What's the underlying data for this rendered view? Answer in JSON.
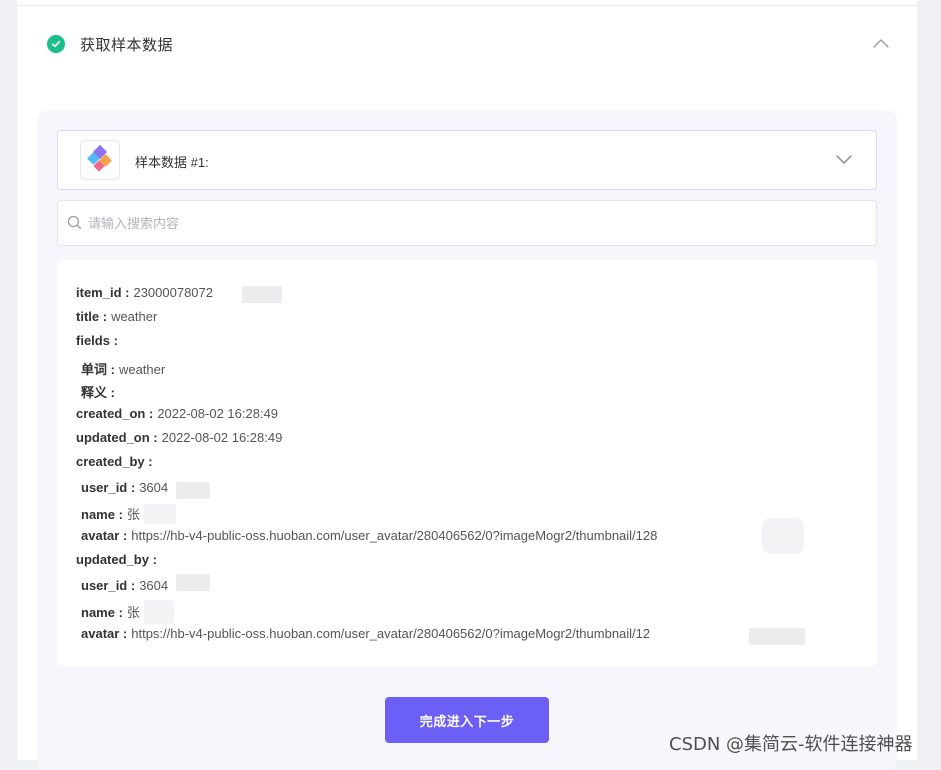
{
  "step": {
    "title": "获取样本数据"
  },
  "selector": {
    "label": "样本数据 #1:"
  },
  "search": {
    "placeholder": "请输入搜索内容"
  },
  "record": {
    "rows": [
      {
        "key": "item_id :",
        "value": "23000078072"
      },
      {
        "key": "title :",
        "value": "weather"
      },
      {
        "key": "fields :",
        "value": ""
      },
      {
        "key": "单词 :",
        "value": "weather"
      },
      {
        "key": "释义 :",
        "value": ""
      },
      {
        "key": "created_on :",
        "value": "2022-08-02 16:28:49"
      },
      {
        "key": "updated_on :",
        "value": "2022-08-02 16:28:49"
      },
      {
        "key": "created_by :",
        "value": ""
      },
      {
        "key": "user_id :",
        "value": "3604"
      },
      {
        "key": "name :",
        "value": "张"
      },
      {
        "key": "avatar :",
        "value": "https://hb-v4-public-oss.huoban.com/user_avatar/280406562/0?imageMogr2/thumbnail/128"
      },
      {
        "key": "updated_by :",
        "value": ""
      },
      {
        "key": "user_id :",
        "value": "3604"
      },
      {
        "key": "name :",
        "value": "张"
      },
      {
        "key": "avatar :",
        "value": "https://hb-v4-public-oss.huoban.com/user_avatar/280406562/0?imageMogr2/thumbnail/12"
      }
    ]
  },
  "next_button": {
    "label": "完成进入下一步"
  },
  "watermark": {
    "text": "CSDN @集简云-软件连接神器"
  },
  "colors": {
    "accent": "#6c5ff6",
    "success": "#19c08c",
    "panel_bg": "#f7f6fd"
  }
}
